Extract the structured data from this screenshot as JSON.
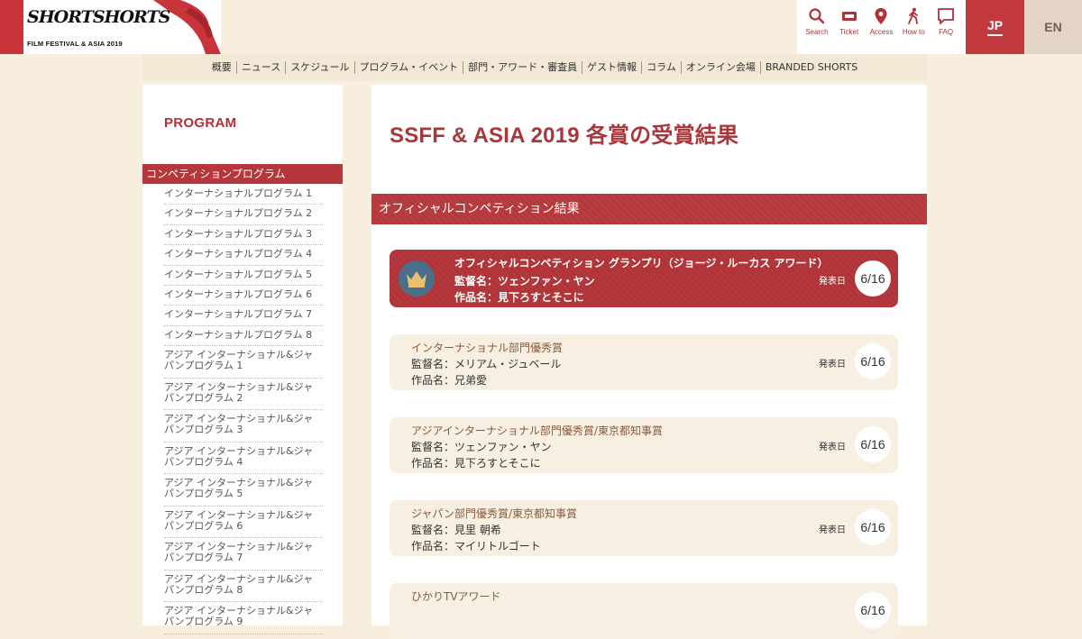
{
  "logo": {
    "main": "SHORTSHORTS",
    "sub": "FILM FESTIVAL & ASIA 2019"
  },
  "util_nav": [
    {
      "icon": "search-icon",
      "label": "Search"
    },
    {
      "icon": "ticket-icon",
      "label": "Ticket"
    },
    {
      "icon": "location-pin-icon",
      "label": "Access"
    },
    {
      "icon": "walking-person-icon",
      "label": "How to"
    },
    {
      "icon": "speech-bubble-icon",
      "label": "FAQ"
    }
  ],
  "lang": {
    "jp": "JP",
    "en": "EN"
  },
  "main_nav": [
    "概要",
    "ニュース",
    "スケジュール",
    "プログラム・イベント",
    "部門・アワード・審査員",
    "ゲスト情報",
    "コラム",
    "オンライン会場",
    "BRANDED SHORTS"
  ],
  "sidebar": {
    "title": "PROGRAM",
    "category": "コンペティションプログラム",
    "items": [
      "インターナショナルプログラム 1",
      "インターナショナルプログラム 2",
      "インターナショナルプログラム 3",
      "インターナショナルプログラム 4",
      "インターナショナルプログラム 5",
      "インターナショナルプログラム 6",
      "インターナショナルプログラム 7",
      "インターナショナルプログラム 8",
      "アジア インターナショナル&ジャパンプログラム 1",
      "アジア インターナショナル&ジャパンプログラム 2",
      "アジア インターナショナル&ジャパンプログラム 3",
      "アジア インターナショナル&ジャパンプログラム 4",
      "アジア インターナショナル&ジャパンプログラム 5",
      "アジア インターナショナル&ジャパンプログラム 6",
      "アジア インターナショナル&ジャパンプログラム 7",
      "アジア インターナショナル&ジャパンプログラム 8",
      "アジア インターナショナル&ジャパンプログラム 9"
    ]
  },
  "main": {
    "title": "SSFF & ASIA 2019 各賞の受賞結果",
    "section": "オフィシャルコンペティション結果",
    "awards": [
      {
        "name": "オフィシャルコンペティション グランプリ（ジョージ・ルーカス アワード）",
        "director": "監督名：ツェンファン・ヤン",
        "work": "作品名：見下ろすとそこに",
        "date_label": "発表日",
        "date": "6/16",
        "grand": true
      },
      {
        "name": "インターナショナル部門優秀賞",
        "director": "監督名：メリアム・ジュベール",
        "work": "作品名：兄弟愛",
        "date_label": "発表日",
        "date": "6/16",
        "grand": false
      },
      {
        "name": "アジアインターナショナル部門優秀賞/東京都知事賞",
        "director": "監督名：ツェンファン・ヤン",
        "work": "作品名：見下ろすとそこに",
        "date_label": "発表日",
        "date": "6/16",
        "grand": false
      },
      {
        "name": "ジャパン部門優秀賞/東京都知事賞",
        "director": "監督名：見里 朝希",
        "work": "作品名：マイリトルゴート",
        "date_label": "発表日",
        "date": "6/16",
        "grand": false
      },
      {
        "name": "ひかりTVアワード",
        "director": "",
        "work": "",
        "date_label": "",
        "date": "6/16",
        "grand": false
      }
    ]
  }
}
